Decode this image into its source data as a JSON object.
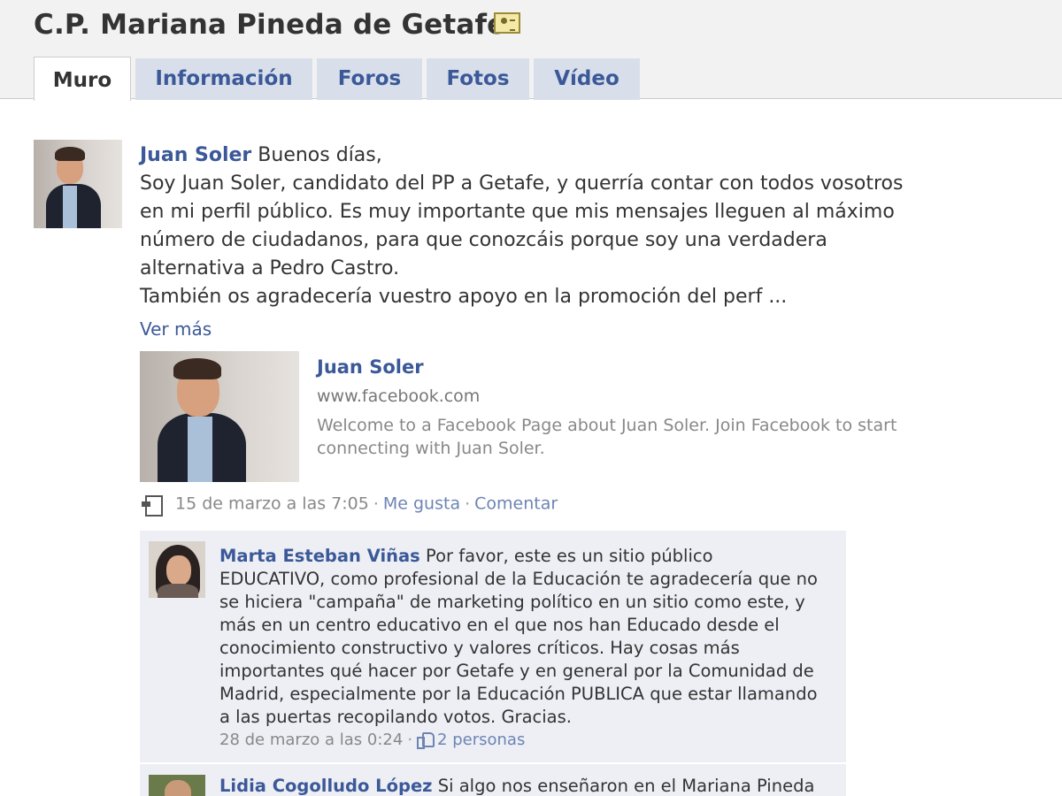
{
  "page": {
    "title": "C.P. Mariana Pineda de Getafe"
  },
  "tabs": [
    {
      "label": "Muro",
      "active": true
    },
    {
      "label": "Información",
      "active": false
    },
    {
      "label": "Foros",
      "active": false
    },
    {
      "label": "Fotos",
      "active": false
    },
    {
      "label": "Vídeo",
      "active": false
    }
  ],
  "post": {
    "author": "Juan Soler",
    "lines": [
      "Buenos días,",
      "Soy Juan Soler, candidato del PP a Getafe, y querría contar con todos vosotros",
      "en mi perfil público. Es muy importante que mis mensajes lleguen al máximo",
      "número de ciudadanos, para que conozcáis porque soy una verdadera",
      "alternativa a Pedro Castro.",
      "También os agradecería vuestro apoyo en la promoción del perf ..."
    ],
    "see_more": "Ver más",
    "attachment": {
      "title": "Juan Soler",
      "url": "www.facebook.com",
      "description_lines": [
        "Welcome to a Facebook Page about Juan Soler. Join Facebook to start",
        "connecting with Juan Soler."
      ]
    },
    "timestamp": "15 de marzo a las 7:05",
    "like_label": "Me gusta",
    "comment_label": "Comentar",
    "separator": "·"
  },
  "comments": [
    {
      "author": "Marta Esteban Viñas",
      "lines": [
        "Por favor, este es un sitio público",
        "EDUCATIVO, como profesional de la Educación te agradecería que no",
        "se hiciera \"campaña\" de marketing político en un sitio como este, y",
        "más en un centro educativo en el que nos han Educado desde el",
        "conocimiento constructivo y valores críticos. Hay cosas más",
        "importantes qué hacer por Getafe y en general por la Comunidad de",
        "Madrid, especialmente por la Educación PUBLICA que estar llamando",
        "a las puertas recopilando votos. Gracias."
      ],
      "timestamp": "28 de marzo a las 0:24",
      "likes": "2 personas"
    },
    {
      "author": "Lidia Cogolludo López",
      "lines": [
        "Si algo nos enseñaron en el Mariana Pineda"
      ]
    }
  ],
  "icons": {
    "title_icon": "contact-card-icon",
    "post_type_icon": "shared-link-icon",
    "like_icon": "thumbs-up-icon"
  },
  "colors": {
    "link_blue": "#3b5998",
    "tab_background": "#d8dfea",
    "comment_background": "#edeff4",
    "header_background": "#f2f2f2"
  }
}
